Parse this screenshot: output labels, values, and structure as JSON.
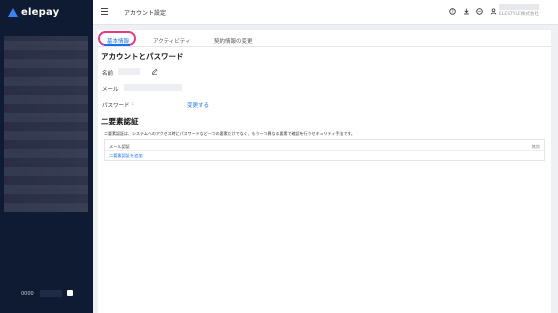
{
  "brand": {
    "name": "elepay",
    "accent": "#3b82f6",
    "sidebar_bg": "#0f1b33"
  },
  "sidebar": {
    "footer_text": "0000"
  },
  "topbar": {
    "title": "アカウント設定",
    "user_company": "ELESTYLE株式会社",
    "icons": [
      "help-icon",
      "download-icon",
      "chat-icon",
      "user-icon"
    ]
  },
  "tabs": [
    {
      "label": "基本情報",
      "active": true
    },
    {
      "label": "アクティビティ",
      "active": false
    },
    {
      "label": "契約情報の変更",
      "active": false
    }
  ],
  "account": {
    "section_title": "アカウントとパスワード",
    "name_label": "名前",
    "email_label": "メール",
    "password_label": "パスワード",
    "change_link": "変更する"
  },
  "mfa": {
    "section_title": "二要素認証",
    "description": "二要素認証は、システムへのアクセス時にパスワードなど一つの要素だけでなく、もう一つ異なる要素で確認を行うセキュリティ手法です。",
    "method_label": "メール認証",
    "status": "無効",
    "add_link": "二要素認証を追加"
  },
  "colors": {
    "link": "#1a73e8",
    "highlight": "#e23a8c"
  }
}
